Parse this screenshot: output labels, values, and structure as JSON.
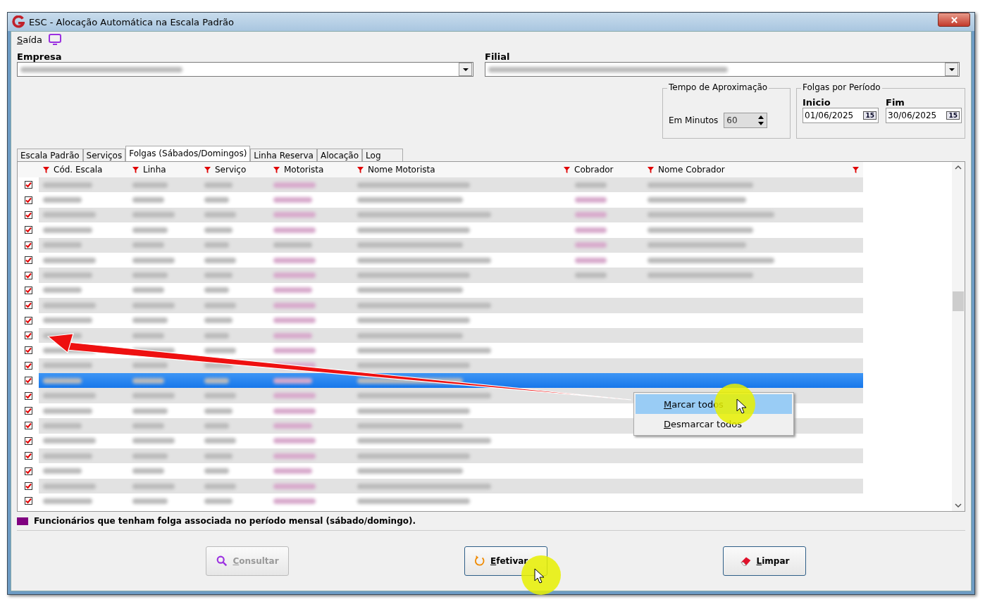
{
  "window": {
    "title": "ESC - Alocação Automática na Escala Padrão"
  },
  "menu": [
    {
      "label": "Saída",
      "mnemonic": true
    }
  ],
  "empresa": {
    "label": "Empresa"
  },
  "filial": {
    "label": "Filial"
  },
  "tempo_aproximacao": {
    "title": "Tempo de Aproximação",
    "field_label": "Em Minutos",
    "value": "60",
    "disabled": true
  },
  "folgas_por_periodo": {
    "title": "Folgas por Período",
    "inicio": {
      "label": "Inicio",
      "value": "01/06/2025",
      "button_text": "15"
    },
    "fim": {
      "label": "Fim",
      "value": "30/06/2025",
      "button_text": "15"
    }
  },
  "tabs": [
    {
      "label": "Escala Padrão",
      "selected": false
    },
    {
      "label": "Serviços",
      "selected": false
    },
    {
      "label": "Folgas (Sábados/Domingos)",
      "selected": true
    },
    {
      "label": "Linha Reserva",
      "selected": false
    },
    {
      "label": "Alocação",
      "selected": false
    },
    {
      "label": "Log",
      "selected": false
    }
  ],
  "table": {
    "columns": [
      {
        "label": "Cód. Escala",
        "filter": true
      },
      {
        "label": "Linha",
        "filter": true
      },
      {
        "label": "Serviço",
        "filter": true
      },
      {
        "label": "Motorista",
        "filter": true
      },
      {
        "label": "Nome Motorista",
        "filter": true
      },
      {
        "label": "Cobrador",
        "filter": true
      },
      {
        "label": "Nome Cobrador",
        "filter": true
      }
    ],
    "end_filter": true,
    "rows": [
      {
        "checked": true,
        "selected": false,
        "shaded": true,
        "motorista_folga": true,
        "has_cobrador": true,
        "cobrador_folga": false
      },
      {
        "checked": true,
        "selected": false,
        "shaded": false,
        "motorista_folga": true,
        "has_cobrador": true,
        "cobrador_folga": true
      },
      {
        "checked": true,
        "selected": false,
        "shaded": true,
        "motorista_folga": true,
        "has_cobrador": true,
        "cobrador_folga": true
      },
      {
        "checked": true,
        "selected": false,
        "shaded": false,
        "motorista_folga": true,
        "has_cobrador": true,
        "cobrador_folga": true
      },
      {
        "checked": true,
        "selected": false,
        "shaded": true,
        "motorista_folga": false,
        "has_cobrador": true,
        "cobrador_folga": true
      },
      {
        "checked": true,
        "selected": false,
        "shaded": false,
        "motorista_folga": true,
        "has_cobrador": true,
        "cobrador_folga": true
      },
      {
        "checked": true,
        "selected": false,
        "shaded": true,
        "motorista_folga": true,
        "has_cobrador": true,
        "cobrador_folga": false
      },
      {
        "checked": true,
        "selected": false,
        "shaded": false,
        "motorista_folga": true,
        "has_cobrador": false
      },
      {
        "checked": true,
        "selected": false,
        "shaded": true,
        "motorista_folga": true,
        "has_cobrador": false
      },
      {
        "checked": true,
        "selected": false,
        "shaded": false,
        "motorista_folga": true,
        "has_cobrador": false
      },
      {
        "checked": true,
        "selected": false,
        "shaded": true,
        "motorista_folga": true,
        "has_cobrador": false
      },
      {
        "checked": true,
        "selected": false,
        "shaded": false,
        "motorista_folga": true,
        "has_cobrador": false
      },
      {
        "checked": true,
        "selected": false,
        "shaded": true,
        "motorista_folga": true,
        "has_cobrador": false
      },
      {
        "checked": true,
        "selected": true,
        "shaded": false,
        "motorista_folga": true,
        "has_cobrador": false
      },
      {
        "checked": true,
        "selected": false,
        "shaded": true,
        "motorista_folga": true,
        "has_cobrador": false
      },
      {
        "checked": true,
        "selected": false,
        "shaded": false,
        "motorista_folga": true,
        "has_cobrador": false
      },
      {
        "checked": true,
        "selected": false,
        "shaded": true,
        "motorista_folga": true,
        "has_cobrador": false
      },
      {
        "checked": true,
        "selected": false,
        "shaded": false,
        "motorista_folga": true,
        "has_cobrador": false
      },
      {
        "checked": true,
        "selected": false,
        "shaded": true,
        "motorista_folga": true,
        "has_cobrador": false
      },
      {
        "checked": true,
        "selected": false,
        "shaded": false,
        "motorista_folga": true,
        "has_cobrador": false
      },
      {
        "checked": true,
        "selected": false,
        "shaded": true,
        "motorista_folga": true,
        "has_cobrador": false
      },
      {
        "checked": true,
        "selected": false,
        "shaded": false,
        "motorista_folga": true,
        "has_cobrador": false
      }
    ]
  },
  "legend": {
    "text": "Funcionários que tenham folga associada no período mensal (sábado/domingo).",
    "color": "#800080"
  },
  "buttons": [
    {
      "label": "Consultar",
      "kind": "search",
      "disabled": true,
      "mnemonic": true
    },
    {
      "label": "Efetivar",
      "kind": "refresh",
      "disabled": false,
      "mnemonic": true
    },
    {
      "label": "Limpar",
      "kind": "eraser",
      "disabled": false,
      "mnemonic": true
    }
  ],
  "context_menu": {
    "items": [
      {
        "label": "Marcar todos",
        "selected": true,
        "mnemonic": true
      },
      {
        "label": "Desmarcar todos",
        "selected": false,
        "mnemonic": true
      }
    ]
  }
}
